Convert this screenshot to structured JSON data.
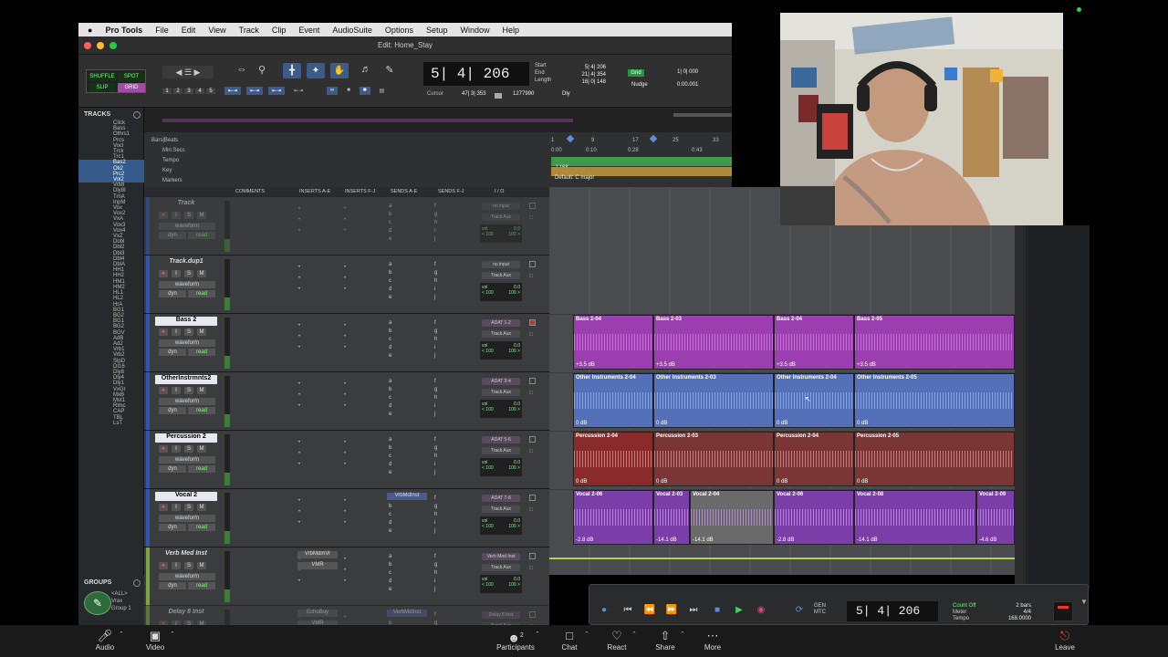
{
  "menu": {
    "apple": "",
    "app": "Pro Tools",
    "items": [
      "File",
      "Edit",
      "View",
      "Track",
      "Clip",
      "Event",
      "AudioSuite",
      "Options",
      "Setup",
      "Window",
      "Help"
    ]
  },
  "window_title": "Edit: Home_Stay",
  "modes": {
    "shuffle": "SHUFFLE",
    "spot": "SPOT",
    "slip": "SLIP",
    "grid": "GRID"
  },
  "zoom_presets": [
    "1",
    "2",
    "3",
    "4",
    "5"
  ],
  "main_counter": "5| 4| 206",
  "counter_labels": {
    "start": "Start",
    "end": "End",
    "length": "Length",
    "cursor": "Cursor"
  },
  "counter_values": {
    "start": "5| 4| 206",
    "end": "21| 4| 354",
    "length": "16| 0| 148",
    "cursor": "47| 3| 353",
    "samples": "1277990",
    "dly": "Dly"
  },
  "grid": {
    "label": "Grid",
    "value": "1| 0| 000"
  },
  "nudge": {
    "label": "Nudge",
    "value": "0:00.001"
  },
  "tracks_panel": {
    "title": "TRACKS",
    "list": [
      "Click",
      "Bass",
      "Othrs1",
      "Prcs",
      "Vocl",
      "Trck",
      "Trc1",
      "Bas2",
      "Oti2",
      "Prc2",
      "Vol2",
      "VrMl",
      "Dly8I",
      "TrnA",
      "InpM",
      "Vox",
      "Vox2",
      "VxA",
      "Vox3",
      "Vox4",
      "VxZ",
      "Dobl",
      "Dbl2",
      "Dbl3",
      "Dbl4",
      "DblA",
      "HH1",
      "HH2",
      "HM1",
      "HM2",
      "HL1",
      "HL2",
      "HrA",
      "BG1",
      "BG2",
      "BG1",
      "BG2",
      "BGV",
      "AdB",
      "Ad2",
      "Vrb1",
      "Vrb2",
      "SlpD",
      "DI16",
      "Dly8",
      "Dly4",
      "Dly1",
      "VxGr",
      "MxB",
      "Mst1",
      "Rlmc",
      "CAP",
      "TBL",
      "LsT"
    ]
  },
  "groups_panel": {
    "title": "GROUPS",
    "all": "<ALL>",
    "items": [
      "Vrax",
      "Group 1"
    ]
  },
  "ruler": {
    "bars_beats": "Bars|Beats",
    "min_secs": "Min:Secs",
    "tempo": "Tempo",
    "key": "Key",
    "markers": "Markers",
    "bar_ticks": [
      "1",
      "9",
      "17",
      "25",
      "33"
    ],
    "sec_ticks": [
      "0:00",
      "0:10",
      "0:28",
      "0:43"
    ],
    "tempo_value": "J 168",
    "key_value": "Default: C major"
  },
  "columns": [
    "COMMENTS",
    "INSERTS A-E",
    "INSERTS F-J",
    "SENDS A-E",
    "SENDS F-J",
    "I / O"
  ],
  "tracks": [
    {
      "name": "Track",
      "input": "no input",
      "output": "Track Aux",
      "vol": "vol",
      "volval": "0.0",
      "pan1": "< 100",
      "pan2": "100 >",
      "selected": false,
      "dim": true
    },
    {
      "name": "Track.dup1",
      "input": "no input",
      "output": "Track Aux",
      "vol": "vol",
      "volval": "0.0",
      "pan1": "< 100",
      "pan2": "100 >",
      "selected": false,
      "dim": false
    },
    {
      "name": "Bass 2",
      "input": "ADAT 1-2",
      "output": "Track Aux",
      "vol": "vol",
      "volval": "0.0",
      "pan1": "< 100",
      "pan2": "100 >",
      "selected": true,
      "dim": false
    },
    {
      "name": "OtherInstrmnts2",
      "input": "ADAT 3-4",
      "output": "Track Aux",
      "vol": "vol",
      "volval": "0.0",
      "pan1": "< 100",
      "pan2": "100 >",
      "selected": true,
      "dim": false
    },
    {
      "name": "Percussion 2",
      "input": "ADAT 5-6",
      "output": "Track Aux",
      "vol": "vol",
      "volval": "0.0",
      "pan1": "< 100",
      "pan2": "100 >",
      "selected": true,
      "dim": false
    },
    {
      "name": "Vocal 2",
      "input": "ADAT 7-8",
      "output": "Track Aux",
      "vol": "vol",
      "volval": "0.0",
      "pan1": "< 100",
      "pan2": "100 >",
      "selected": true,
      "dim": false,
      "send": "VrbMdInst"
    },
    {
      "name": "Verb Med Inst",
      "input": "Verb Med Inst",
      "output": "Track Aux",
      "vol": "vol",
      "volval": "0.0",
      "pan1": "< 100",
      "pan2": "100 >",
      "selected": false,
      "dim": false,
      "inserts": [
        "VrbMdmVr",
        "VMR"
      ]
    },
    {
      "name": "Delay 8 Inst",
      "input": "Delay 8 Inst",
      "output": "Track Aux",
      "vol": "vol",
      "volval": "0.0",
      "pan1": "",
      "pan2": "",
      "selected": false,
      "dim": true,
      "inserts": [
        "EchoBoy",
        "VMR"
      ],
      "send": "VerbMdInst"
    }
  ],
  "track_buttons": {
    "rec": "●",
    "input": "I",
    "solo": "S",
    "mute": "M",
    "waveform": "waveform",
    "dyn": "dyn",
    "read": "read"
  },
  "clips": {
    "bass": [
      {
        "name": "Bass 2-04",
        "gain": "+3.5 dB"
      },
      {
        "name": "Bass 2-03",
        "gain": "+3.5 dB"
      },
      {
        "name": "Bass 2-04",
        "gain": "+3.5 dB"
      },
      {
        "name": "Bass 2-05",
        "gain": "+3.5 dB"
      }
    ],
    "other": [
      {
        "name": "Other Instruments 2-04",
        "gain": "0 dB"
      },
      {
        "name": "Other Instruments 2-03",
        "gain": "0 dB"
      },
      {
        "name": "Other Instruments 2-04",
        "gain": "0 dB"
      },
      {
        "name": "Other Instruments 2-05",
        "gain": "0 dB"
      }
    ],
    "perc": [
      {
        "name": "Percussion 2-04",
        "gain": "0 dB"
      },
      {
        "name": "Percussion 2-03",
        "gain": "0 dB"
      },
      {
        "name": "Percussion 2-04",
        "gain": "0 dB"
      },
      {
        "name": "Percussion 2-05",
        "gain": "0 dB"
      }
    ],
    "vocal": [
      {
        "name": "Vocal 2-06",
        "gain": "-2.8 dB"
      },
      {
        "name": "Vocal 2-03",
        "gain": "-14.1 dB"
      },
      {
        "name": "Vocal 2-04",
        "gain": "-14.1 dB"
      },
      {
        "name": "Vocal 2-06",
        "gain": "-2.8 dB"
      },
      {
        "name": "Vocal 2-08",
        "gain": "-14.1 dB"
      },
      {
        "name": "Vocal 2-09",
        "gain": "-4.6 dB"
      }
    ]
  },
  "transport": {
    "counter": "5| 4| 206",
    "gen": "GEN",
    "mtc": "MTC",
    "count_off": "Count Off",
    "meter": "Meter",
    "tempo": "Tempo",
    "bars": "2 bars",
    "meter_val": "4/4",
    "tempo_val": "168.0000"
  },
  "zoom": {
    "audio": "Audio",
    "video": "Video",
    "participants": "Participants",
    "participants_count": "2",
    "chat": "Chat",
    "react": "React",
    "share": "Share",
    "more": "More",
    "leave": "Leave"
  },
  "colors": {
    "bass": "#9b3fb0",
    "other": "#5470b8",
    "perc": "#7a3535",
    "vocal": "#7b3ea8",
    "accent": "#79f08a"
  }
}
